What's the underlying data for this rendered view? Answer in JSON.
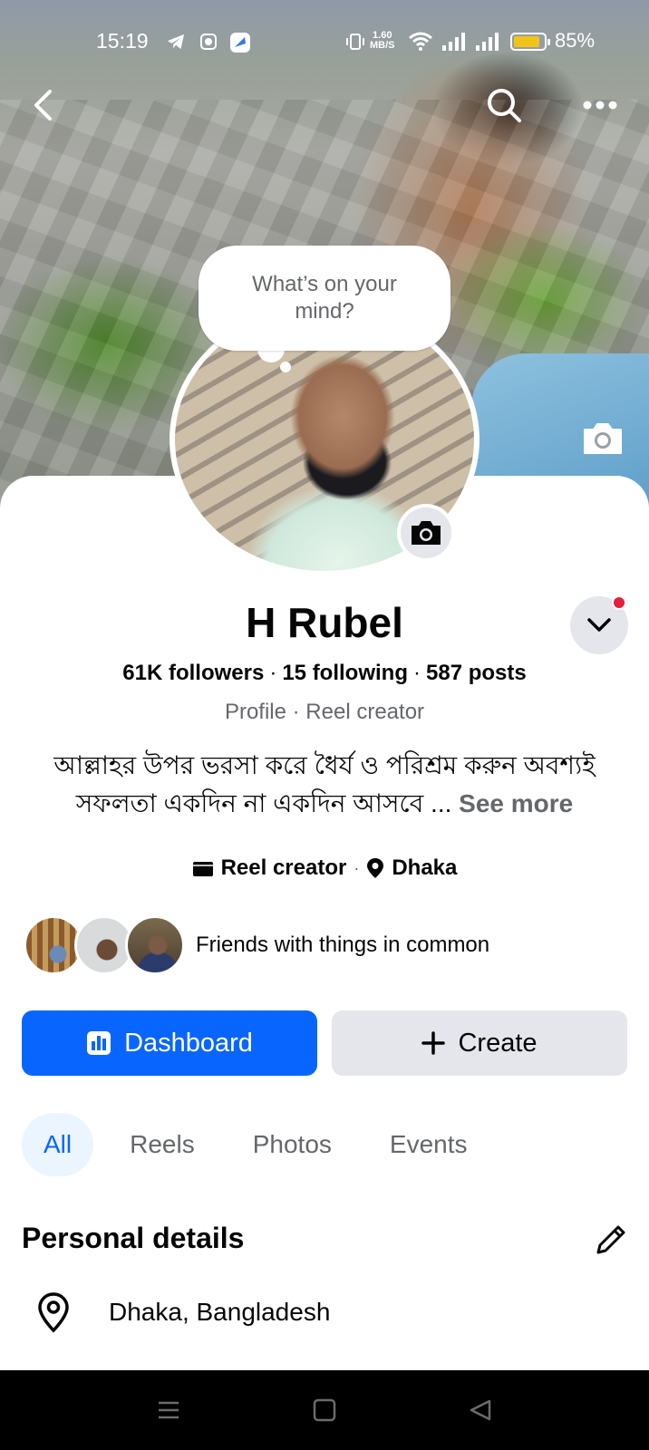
{
  "status_bar": {
    "time": "15:19",
    "net_speed_value": "1.60",
    "net_speed_unit": "MB/S",
    "battery": "85%"
  },
  "bubble": {
    "text": "What’s on your mind?"
  },
  "profile": {
    "name": "H Rubel",
    "followers": "61K followers",
    "following": "15 following",
    "posts": "587 posts",
    "separator": "·",
    "subtitle": "Profile · Reel creator",
    "bio": "আল্লাহর উপর ভরসা করে ধৈর্য ও পরিশ্রম করুন অবশ্যই সফলতা একদিন না একদিন আসবে ...",
    "see_more": "See more",
    "category": "Reel creator",
    "location": "Dhaka",
    "friends_text": "Friends with things in common"
  },
  "buttons": {
    "dashboard": "Dashboard",
    "create": "Create"
  },
  "tabs": [
    {
      "label": "All",
      "active": true
    },
    {
      "label": "Reels",
      "active": false
    },
    {
      "label": "Photos",
      "active": false
    },
    {
      "label": "Events",
      "active": false
    }
  ],
  "personal_details": {
    "title": "Personal details",
    "location": "Dhaka, Bangladesh"
  },
  "colors": {
    "accent": "#0866ff",
    "secondary_button": "#e4e6eb",
    "notification_dot": "#e41e3f",
    "muted_text": "#65676b"
  }
}
